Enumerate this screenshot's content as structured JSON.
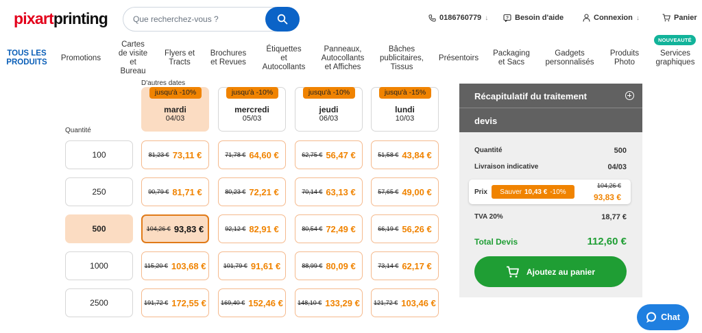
{
  "header": {
    "logo_red": "pixart",
    "logo_black": "printing",
    "search_placeholder": "Que recherchez-vous ?",
    "phone": "0186760779",
    "help": "Besoin d'aide",
    "login": "Connexion",
    "cart": "Panier"
  },
  "nav": {
    "items": [
      [
        "TOUS LES",
        "PRODUITS"
      ],
      [
        "Promotions"
      ],
      [
        "Cartes",
        "de visite",
        "et",
        "Bureau"
      ],
      [
        "Flyers et",
        "Tracts"
      ],
      [
        "Brochures",
        "et Revues"
      ],
      [
        "Étiquettes",
        "et",
        "Autocollants"
      ],
      [
        "Panneaux,",
        "Autocollants",
        "et Affiches"
      ],
      [
        "Bâches",
        "publicitaires,",
        "Tissus"
      ],
      [
        "Présentoirs"
      ],
      [
        "Packaging",
        "et Sacs"
      ],
      [
        "Gadgets",
        "personnalisés"
      ],
      [
        "Produits",
        "Photo"
      ],
      [
        "Services",
        "graphiques"
      ]
    ],
    "new_badge": "NOUVEAUTÉ"
  },
  "table": {
    "other_dates_label": "D'autres dates",
    "quantity_label": "Quantité",
    "dates": [
      {
        "discount": "jusqu'à -10%",
        "day": "mardi",
        "date": "04/03"
      },
      {
        "discount": "jusqu'à -10%",
        "day": "mercredi",
        "date": "05/03"
      },
      {
        "discount": "jusqu'à -10%",
        "day": "jeudi",
        "date": "06/03"
      },
      {
        "discount": "jusqu'à -15%",
        "day": "lundi",
        "date": "10/03"
      }
    ],
    "rows": [
      {
        "qty": "100",
        "prices": [
          [
            "81,23 €",
            "73,11 €"
          ],
          [
            "71,78 €",
            "64,60 €"
          ],
          [
            "62,75 €",
            "56,47 €"
          ],
          [
            "51,58 €",
            "43,84 €"
          ]
        ]
      },
      {
        "qty": "250",
        "prices": [
          [
            "90,79 €",
            "81,71 €"
          ],
          [
            "80,23 €",
            "72,21 €"
          ],
          [
            "70,14 €",
            "63,13 €"
          ],
          [
            "57,65 €",
            "49,00 €"
          ]
        ]
      },
      {
        "qty": "500",
        "prices": [
          [
            "104,26 €",
            "93,83 €"
          ],
          [
            "92,12 €",
            "82,91 €"
          ],
          [
            "80,54 €",
            "72,49 €"
          ],
          [
            "66,19 €",
            "56,26 €"
          ]
        ]
      },
      {
        "qty": "1000",
        "prices": [
          [
            "115,20 €",
            "103,68 €"
          ],
          [
            "101,79 €",
            "91,61 €"
          ],
          [
            "88,99 €",
            "80,09 €"
          ],
          [
            "73,14 €",
            "62,17 €"
          ]
        ]
      },
      {
        "qty": "2500",
        "prices": [
          [
            "191,72 €",
            "172,55 €"
          ],
          [
            "169,40 €",
            "152,46 €"
          ],
          [
            "148,10 €",
            "133,29 €"
          ],
          [
            "121,72 €",
            "103,46 €"
          ]
        ]
      }
    ]
  },
  "summary": {
    "title_line1": "Récapitulatif du traitement",
    "title_line2": "devis",
    "quantity_label": "Quantité",
    "quantity_value": "500",
    "delivery_label": "Livraison indicative",
    "delivery_value": "04/03",
    "price_label": "Prix",
    "save_text": "Sauver",
    "save_amount": "10,43 €",
    "save_pct": "-10%",
    "old_price": "104,26 €",
    "new_price": "93,83 €",
    "vat_label": "TVA 20%",
    "vat_value": "18,77 €",
    "total_label": "Total Devis",
    "total_value": "112,60 €",
    "cart_button": "Ajoutez au panier"
  },
  "chat": {
    "label": "Chat"
  },
  "colors": {
    "accent_orange": "#f08300",
    "selected_bg": "#fbdcc2",
    "green": "#1f9e34",
    "blue": "#0b63c7"
  }
}
